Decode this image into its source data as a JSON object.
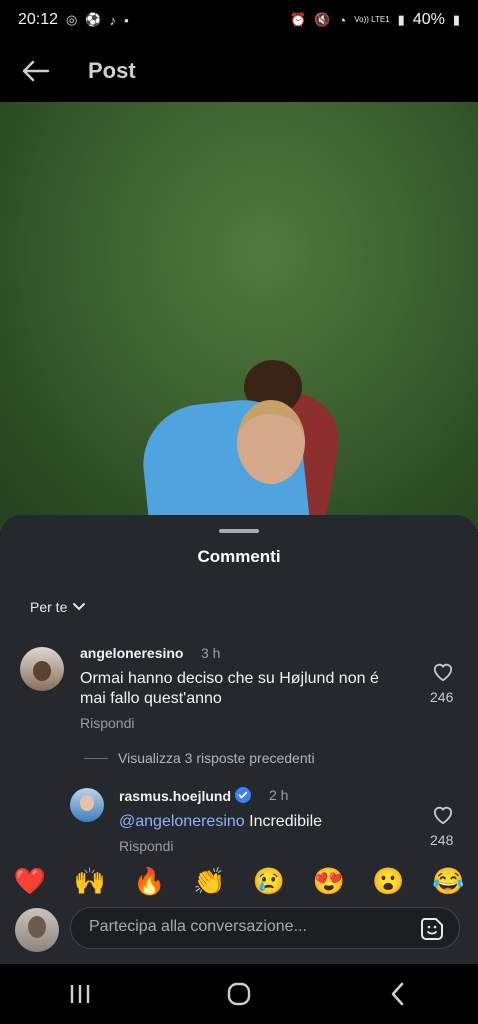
{
  "status_bar": {
    "time": "20:12",
    "battery": "40%",
    "network": "Vo)) LTE1"
  },
  "header": {
    "title": "Post"
  },
  "comments_sheet": {
    "title": "Commenti",
    "sort_label": "Per te",
    "comments": [
      {
        "username": "angeloneresino",
        "time": "3 h",
        "text": "Ormai hanno deciso che su Højlund non é mai fallo quest'anno",
        "reply_label": "Rispondi",
        "likes": "246"
      }
    ],
    "view_replies": "Visualizza 3 risposte precedenti",
    "replies": [
      {
        "username": "rasmus.hoejlund",
        "verified": true,
        "time": "2 h",
        "mention": "@angeloneresino",
        "text": "Incredibile",
        "reply_label": "Rispondi",
        "likes": "248"
      }
    ]
  },
  "emoji_bar": [
    "❤️",
    "🙌",
    "🔥",
    "👏",
    "😢",
    "😍",
    "😮",
    "😂"
  ],
  "composer": {
    "placeholder": "Partecipa alla conversazione..."
  },
  "colors": {
    "sheet_bg": "#25282d",
    "mention": "#8ab4f8",
    "verified": "#3b82f6"
  }
}
